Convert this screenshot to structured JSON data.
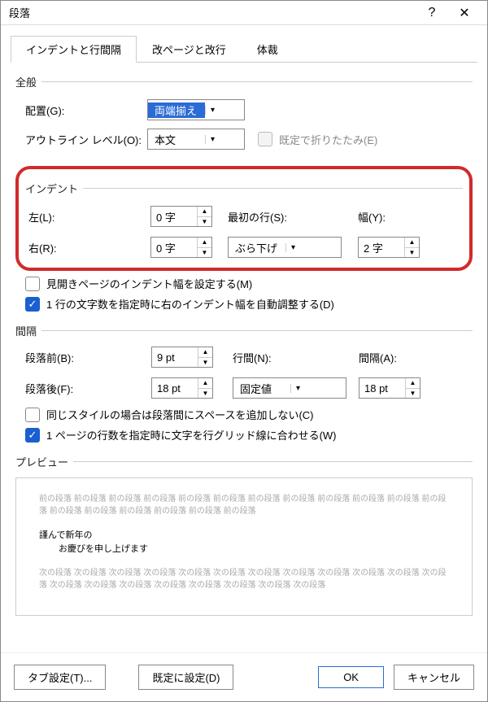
{
  "title": "段落",
  "tabs": [
    "インデントと行間隔",
    "改ページと改行",
    "体裁"
  ],
  "general": {
    "title": "全般",
    "align_label": "配置(G):",
    "align_value": "両端揃え",
    "outline_label": "アウトライン レベル(O):",
    "outline_value": "本文",
    "collapse_label": "既定で折りたたみ(E)"
  },
  "indent": {
    "title": "インデント",
    "left_label": "左(L):",
    "left_value": "0 字",
    "right_label": "右(R):",
    "right_value": "0 字",
    "firstline_label": "最初の行(S):",
    "firstline_value": "ぶら下げ",
    "by_label": "幅(Y):",
    "by_value": "2 字",
    "mirror_label": "見開きページのインデント幅を設定する(M)",
    "auto_label": "1 行の文字数を指定時に右のインデント幅を自動調整する(D)"
  },
  "spacing": {
    "title": "間隔",
    "before_label": "段落前(B):",
    "before_value": "9 pt",
    "after_label": "段落後(F):",
    "after_value": "18 pt",
    "line_label": "行間(N):",
    "line_value": "固定値",
    "at_label": "間隔(A):",
    "at_value": "18 pt",
    "samestyle_label": "同じスタイルの場合は段落間にスペースを追加しない(C)",
    "snap_label": "1 ページの行数を指定時に文字を行グリッド線に合わせる(W)"
  },
  "preview": {
    "title": "プレビュー",
    "prev_text": "前の段落 前の段落 前の段落 前の段落 前の段落 前の段落 前の段落 前の段落 前の段落 前の段落 前の段落 前の段落 前の段落 前の段落 前の段落 前の段落 前の段落 前の段落",
    "sample_line1": "謹んで新年の",
    "sample_line2": "お慶びを申し上げます",
    "next_text": "次の段落 次の段落 次の段落 次の段落 次の段落 次の段落 次の段落 次の段落 次の段落 次の段落 次の段落 次の段落 次の段落 次の段落 次の段落 次の段落 次の段落 次の段落 次の段落 次の段落"
  },
  "footer": {
    "tabs_btn": "タブ設定(T)...",
    "default_btn": "既定に設定(D)",
    "ok": "OK",
    "cancel": "キャンセル"
  }
}
